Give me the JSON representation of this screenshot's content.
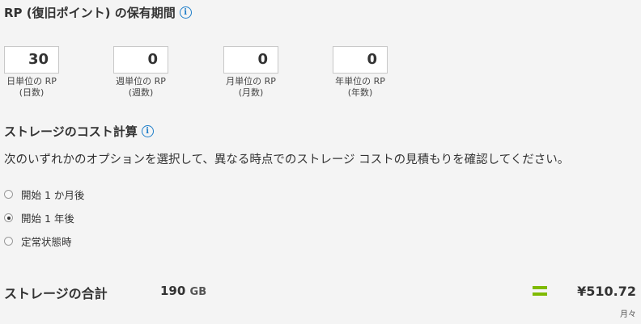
{
  "rp_section": {
    "title": "RP (復旧ポイント) の保有期間",
    "info_icon": "i",
    "fields": [
      {
        "value": "30",
        "label1": "日単位の RP",
        "label2": "(日数)"
      },
      {
        "value": "0",
        "label1": "週単位の RP",
        "label2": "(週数)"
      },
      {
        "value": "0",
        "label1": "月単位の RP",
        "label2": "(月数)"
      },
      {
        "value": "0",
        "label1": "年単位の RP",
        "label2": "(年数)"
      }
    ]
  },
  "storage_section": {
    "title": "ストレージのコスト計算",
    "info_icon": "i",
    "description": "次のいずれかのオプションを選択して、異なる時点でのストレージ コストの見積もりを確認してください。",
    "options": [
      {
        "label": "開始 1 か月後",
        "selected": false
      },
      {
        "label": "開始 1 年後",
        "selected": true
      },
      {
        "label": "定常状態時",
        "selected": false
      }
    ]
  },
  "total": {
    "label": "ストレージの合計",
    "size_value": "190",
    "size_unit": "GB",
    "price": "¥510.72",
    "period": "月々"
  },
  "colors": {
    "accent_green": "#7fba00",
    "info_blue": "#1f7ec9"
  }
}
